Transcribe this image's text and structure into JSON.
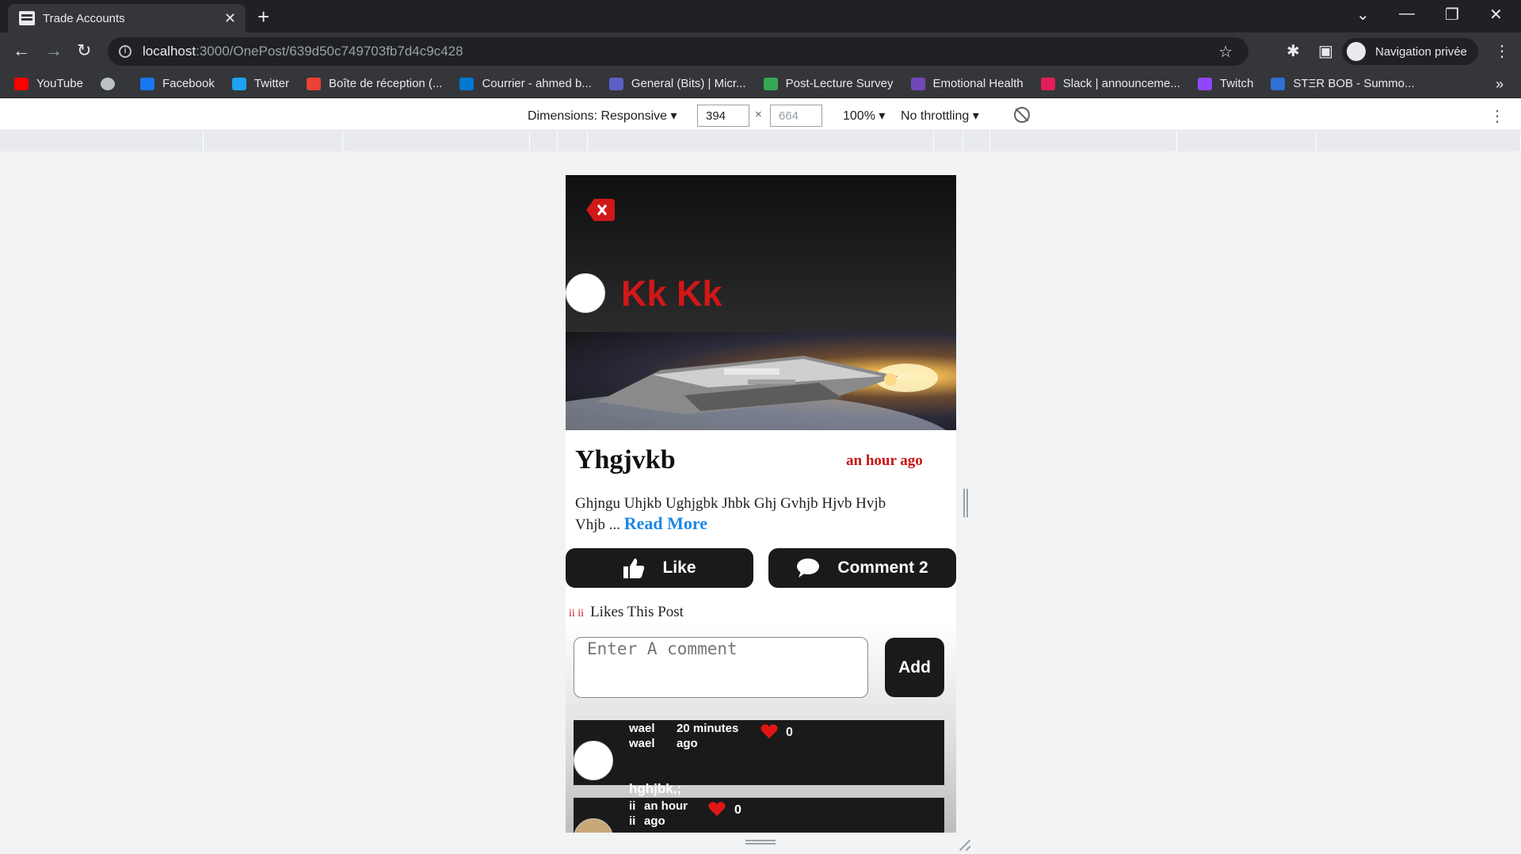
{
  "browser": {
    "tab_title": "Trade Accounts",
    "url_host": "localhost",
    "url_path": ":3000/OnePost/639d50c749703fb7d4c9c428",
    "profile_label": "Navigation privée",
    "bookmarks": [
      {
        "label": "YouTube",
        "color": "#ff0000"
      },
      {
        "label": "",
        "color": "#bdc1c6"
      },
      {
        "label": "Facebook",
        "color": "#1877f2"
      },
      {
        "label": "Twitter",
        "color": "#1da1f2"
      },
      {
        "label": "Boîte de réception (...",
        "color": "#ea4335"
      },
      {
        "label": "Courrier - ahmed b...",
        "color": "#0078d4"
      },
      {
        "label": "General (Bits) | Micr...",
        "color": "#5b5fc7"
      },
      {
        "label": "Post-Lecture Survey",
        "color": "#34a853"
      },
      {
        "label": "Emotional Health",
        "color": "#7248b9"
      },
      {
        "label": "Slack | announceme...",
        "color": "#e01e5a"
      },
      {
        "label": "Twitch",
        "color": "#9146ff"
      },
      {
        "label": "STΞR BOB - Summo...",
        "color": "#2f6fd6"
      }
    ]
  },
  "devtools": {
    "dimensions_label": "Dimensions: Responsive",
    "width": "394",
    "height": "664",
    "zoom": "100%",
    "throttling": "No throttling"
  },
  "post": {
    "author": "Kk Kk",
    "title": "Yhgjvkb",
    "time": "an hour ago",
    "description": "Ghjngu Uhjkb Ughjgbk Jhbk Ghj Gvhjb Hjvb Hvjb Vhjb ...",
    "read_more": "Read More",
    "like_label": "Like",
    "comment_label": "Comment 2",
    "likes_names": "ii ii",
    "likes_text": "Likes This Post",
    "comment_placeholder": "Enter A comment",
    "add_label": "Add",
    "accent_color": "#d01818"
  },
  "comments": [
    {
      "user": "wael wael",
      "time": "20 minutes ago",
      "likes": "0",
      "text": "hghjbk,;"
    },
    {
      "user": "ii ii",
      "time": "an hour ago",
      "likes": "0",
      "text": ""
    }
  ]
}
